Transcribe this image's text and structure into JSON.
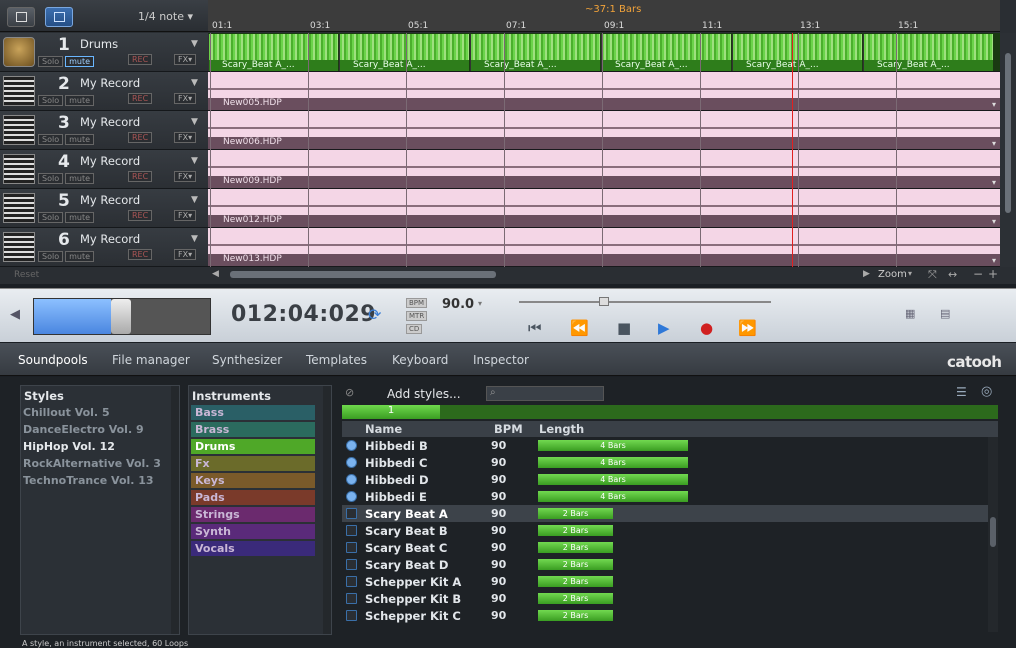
{
  "arranger": {
    "quantize": "1/4 note",
    "bars_info": "~37:1 Bars",
    "bars": [
      "01:1",
      "03:1",
      "05:1",
      "07:1",
      "09:1",
      "11:1",
      "13:1",
      "15:1"
    ],
    "zoom_label": "Zoom",
    "reset_label": "Reset",
    "tracks": [
      {
        "num": "1",
        "name": "Drums",
        "solo": "Solo",
        "mute": "mute",
        "rec": "REC",
        "fx": "FX",
        "clip": "Scary_Beat A_..."
      },
      {
        "num": "2",
        "name": "My Record",
        "solo": "Solo",
        "mute": "mute",
        "rec": "REC",
        "fx": "FX",
        "clip": "New005.HDP"
      },
      {
        "num": "3",
        "name": "My Record",
        "solo": "Solo",
        "mute": "mute",
        "rec": "REC",
        "fx": "FX",
        "clip": "New006.HDP"
      },
      {
        "num": "4",
        "name": "My Record",
        "solo": "Solo",
        "mute": "mute",
        "rec": "REC",
        "fx": "FX",
        "clip": "New009.HDP"
      },
      {
        "num": "5",
        "name": "My Record",
        "solo": "Solo",
        "mute": "mute",
        "rec": "REC",
        "fx": "FX",
        "clip": "New012.HDP"
      },
      {
        "num": "6",
        "name": "My Record",
        "solo": "Solo",
        "mute": "mute",
        "rec": "REC",
        "fx": "FX",
        "clip": "New013.HDP"
      }
    ]
  },
  "transport": {
    "position_fraction": 0.44,
    "timecode": "012:04:029",
    "bpm_label": "BPM",
    "bpm": "90.0",
    "mtr_label": "MTR",
    "volume_fraction": 0.32
  },
  "tabs": [
    "Soundpools",
    "File manager",
    "Synthesizer",
    "Templates",
    "Keyboard",
    "Inspector"
  ],
  "logo": "catooh",
  "soundpool": {
    "styles_header": "Styles",
    "styles": [
      "Chillout Vol. 5",
      "DanceElectro Vol. 9",
      "HipHop Vol. 12",
      "RockAlternative Vol. 3",
      "TechnoTrance Vol. 13"
    ],
    "selected_style": "HipHop Vol. 12",
    "instruments_header": "Instruments",
    "instruments": [
      {
        "name": "Bass",
        "color": "#2a5f66"
      },
      {
        "name": "Brass",
        "color": "#2b6b5e"
      },
      {
        "name": "Drums",
        "color": "#4fa828"
      },
      {
        "name": "Fx",
        "color": "#6b6b2a"
      },
      {
        "name": "Keys",
        "color": "#7a5a2a"
      },
      {
        "name": "Pads",
        "color": "#7a3a2a"
      },
      {
        "name": "Strings",
        "color": "#6b2a6e"
      },
      {
        "name": "Synth",
        "color": "#5a2a7a"
      },
      {
        "name": "Vocals",
        "color": "#3a2a7a"
      }
    ],
    "add_styles": "Add styles...",
    "page": "1",
    "columns": {
      "name": "Name",
      "bpm": "BPM",
      "length": "Length"
    },
    "loops": [
      {
        "name": "Hibbedi B",
        "bpm": "90",
        "length": "4 Bars",
        "bars": 4
      },
      {
        "name": "Hibbedi C",
        "bpm": "90",
        "length": "4 Bars",
        "bars": 4
      },
      {
        "name": "Hibbedi D",
        "bpm": "90",
        "length": "4 Bars",
        "bars": 4
      },
      {
        "name": "Hibbedi E",
        "bpm": "90",
        "length": "4 Bars",
        "bars": 4
      },
      {
        "name": "Scary Beat A",
        "bpm": "90",
        "length": "2 Bars",
        "bars": 2
      },
      {
        "name": "Scary Beat B",
        "bpm": "90",
        "length": "2 Bars",
        "bars": 2
      },
      {
        "name": "Scary Beat C",
        "bpm": "90",
        "length": "2 Bars",
        "bars": 2
      },
      {
        "name": "Scary Beat D",
        "bpm": "90",
        "length": "2 Bars",
        "bars": 2
      },
      {
        "name": "Schepper Kit A",
        "bpm": "90",
        "length": "2 Bars",
        "bars": 2
      },
      {
        "name": "Schepper Kit B",
        "bpm": "90",
        "length": "2 Bars",
        "bars": 2
      },
      {
        "name": "Schepper Kit C",
        "bpm": "90",
        "length": "2 Bars",
        "bars": 2
      }
    ],
    "selected_loop": "Scary Beat A",
    "status": "A style, an instrument selected, 60 Loops"
  }
}
